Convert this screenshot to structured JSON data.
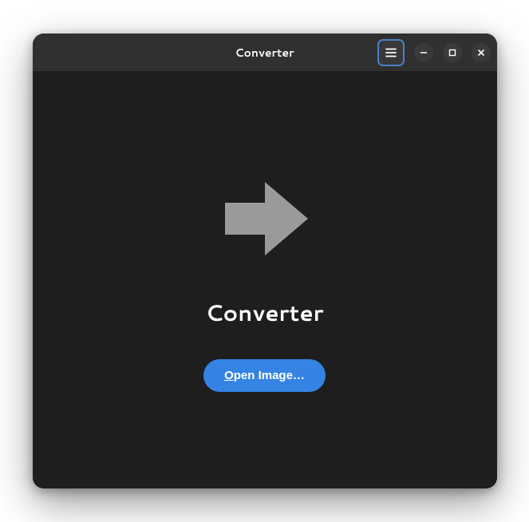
{
  "titlebar": {
    "title": "Converter"
  },
  "main": {
    "heading": "Converter",
    "open_button_mnemonic": "O",
    "open_button_rest": "pen Image…"
  },
  "icons": {
    "menu": "hamburger-icon",
    "minimize": "minimize-icon",
    "maximize": "maximize-icon",
    "close": "close-icon",
    "arrow": "arrow-right-icon"
  },
  "colors": {
    "accent": "#3584e4",
    "window_bg": "#1e1e1e",
    "titlebar_bg": "#303030",
    "icon_gray": "#9a9a9a"
  }
}
